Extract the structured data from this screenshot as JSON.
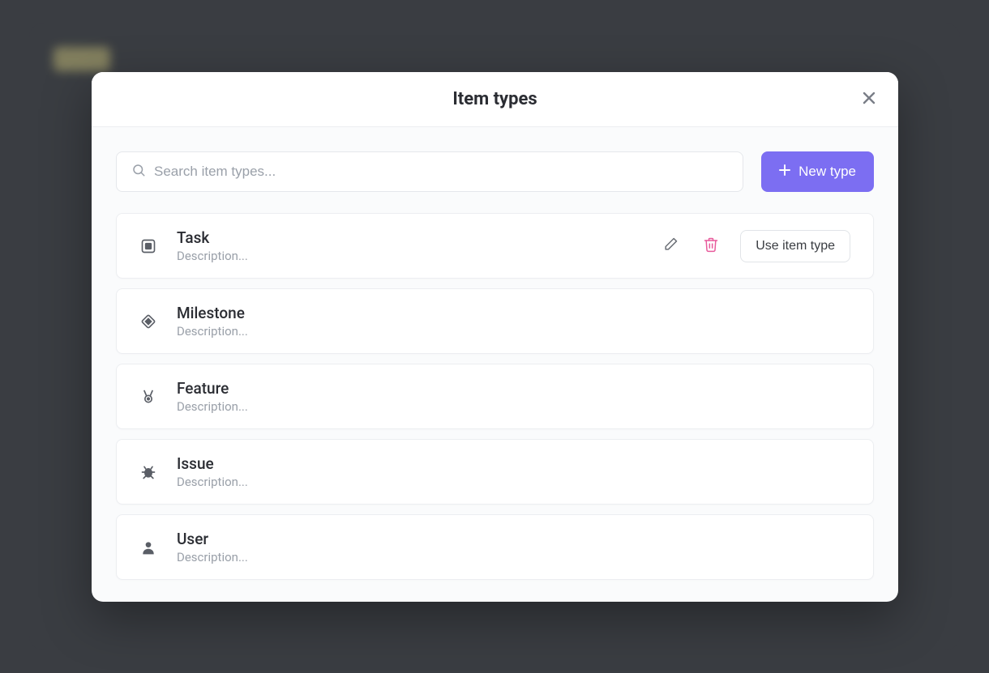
{
  "modal": {
    "title": "Item types",
    "search_placeholder": "Search item types...",
    "new_type_label": "New type",
    "use_button_label": "Use item type"
  },
  "item_types": [
    {
      "name": "Task",
      "description": "Description...",
      "icon": "square-icon",
      "hovered": true
    },
    {
      "name": "Milestone",
      "description": "Description...",
      "icon": "diamond-icon",
      "hovered": false
    },
    {
      "name": "Feature",
      "description": "Description...",
      "icon": "medal-icon",
      "hovered": false
    },
    {
      "name": "Issue",
      "description": "Description...",
      "icon": "bug-icon",
      "hovered": false
    },
    {
      "name": "User",
      "description": "Description...",
      "icon": "user-icon",
      "hovered": false
    }
  ],
  "colors": {
    "accent": "#7c6ef2",
    "danger": "#e85b9c"
  }
}
